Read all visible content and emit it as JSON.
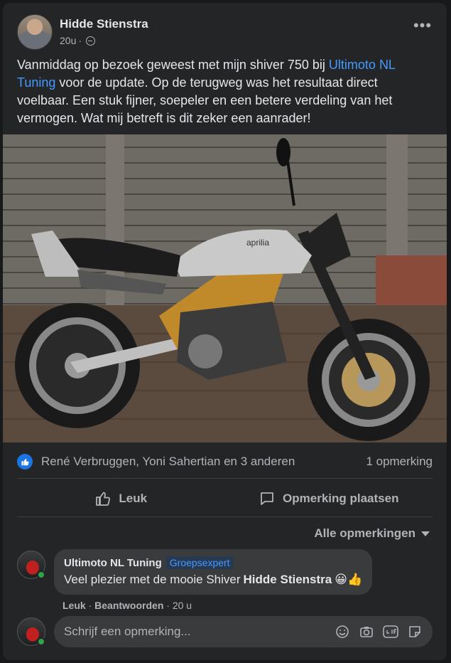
{
  "post": {
    "author": "Hidde Stienstra",
    "time": "20u",
    "separator": "·",
    "more_label": "•••",
    "text_before_link": "Vanmiddag op bezoek geweest met mijn shiver 750 bij ",
    "link_text": "Ultimoto NL Tuning",
    "text_after_link": " voor de update. Op de terugweg was het resultaat direct voelbaar. Een stuk fijner, soepeler en een betere verdeling van het vermogen. Wat mij betreft is dit zeker een aanrader!",
    "photo_brand_text": "aprilia"
  },
  "reactions": {
    "names": "René Verbruggen, Yoni Sahertian en 3 anderen",
    "comment_count": "1 opmerking"
  },
  "actions": {
    "like_label": "Leuk",
    "comment_label": "Opmerking plaatsen"
  },
  "comments_filter": "Alle opmerkingen",
  "comment": {
    "author": "Ultimoto NL Tuning",
    "badge": "Groepsexpert",
    "text": "Veel plezier met de mooie Shiver",
    "mention": "Hidde Stienstra",
    "emoji": "😀👍",
    "like": "Leuk",
    "reply": "Beantwoorden",
    "time": "20 u",
    "dot": " · "
  },
  "composer": {
    "placeholder": "Schrijf een opmerking..."
  },
  "icons": [
    "globe-icon",
    "more-icon",
    "like-badge-icon",
    "thumb-up-icon",
    "speech-bubble-icon",
    "caret-down-icon",
    "emoji-icon",
    "camera-icon",
    "gif-icon",
    "sticker-icon"
  ],
  "colors": {
    "background": "#18191a",
    "card": "#242526",
    "link": "#4599ff",
    "like_blue": "#1b74e4",
    "online": "#31a24c"
  }
}
